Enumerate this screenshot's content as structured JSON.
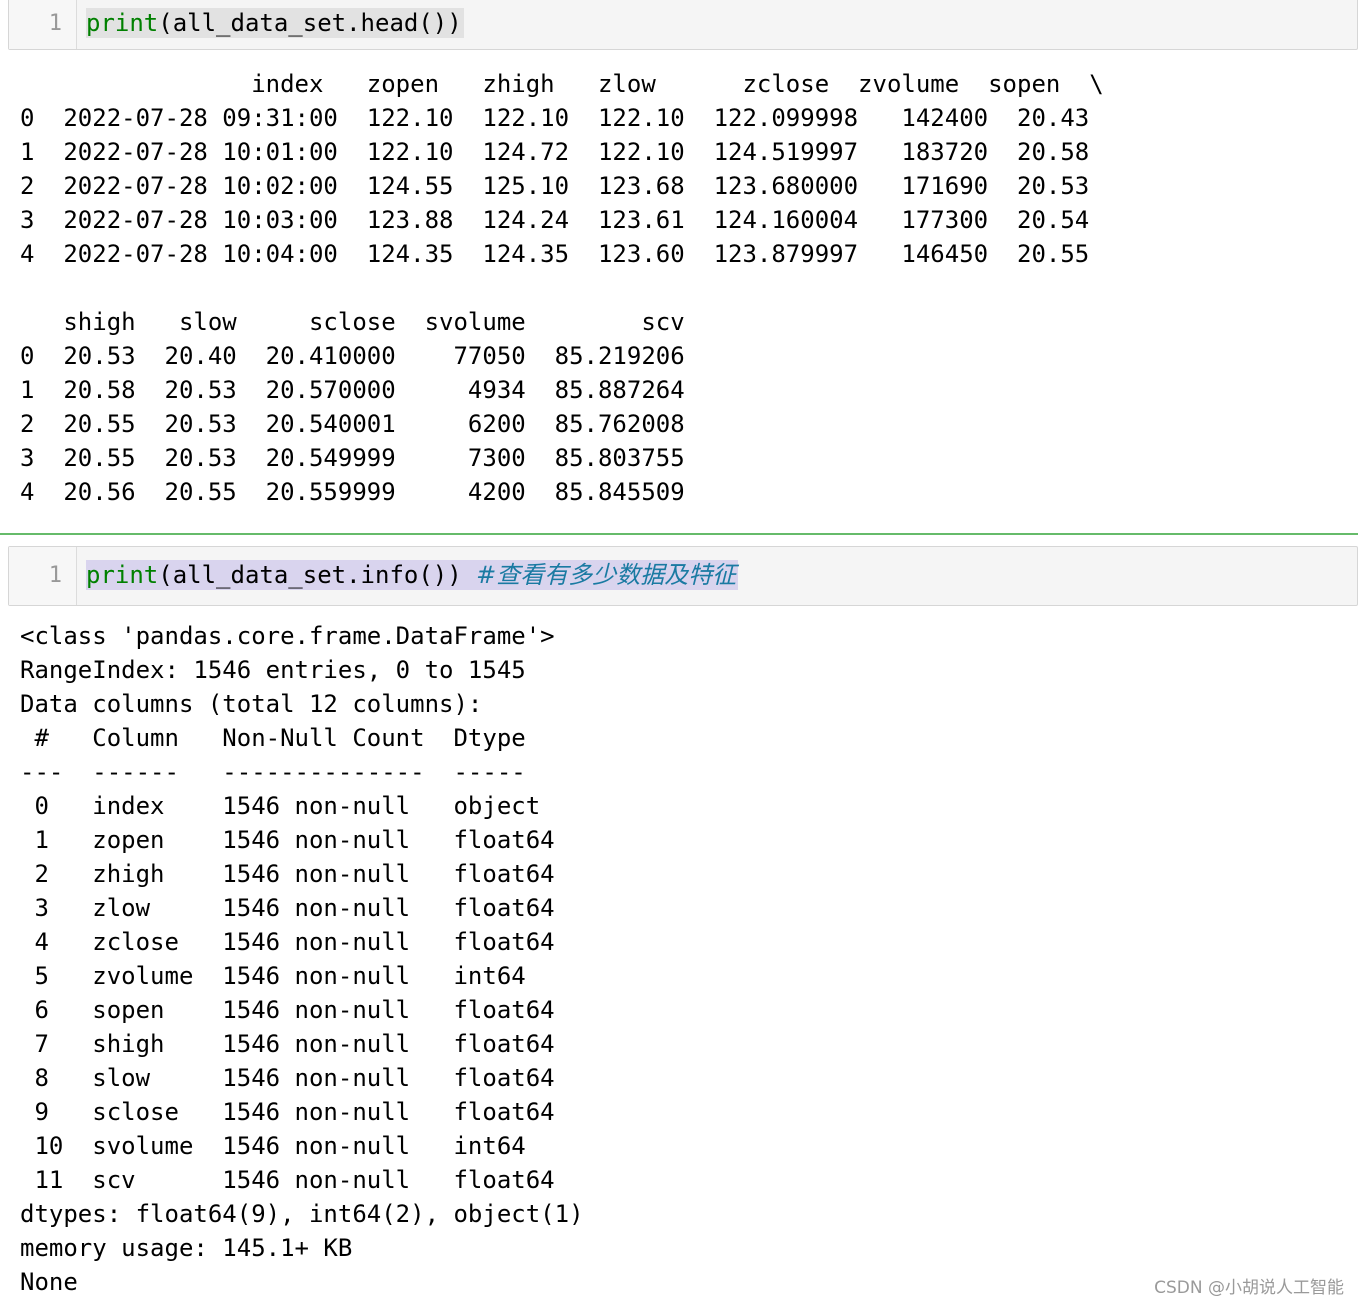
{
  "cell1": {
    "line_number": "1",
    "code_keyword": "print",
    "code_rest": "(all_data_set.head())",
    "output_block1": [
      "                index   zopen   zhigh   zlow      zclose  zvolume  sopen  \\",
      "0  2022-07-28 09:31:00  122.10  122.10  122.10  122.099998   142400  20.43",
      "1  2022-07-28 10:01:00  122.10  124.72  122.10  124.519997   183720  20.58",
      "2  2022-07-28 10:02:00  124.55  125.10  123.68  123.680000   171690  20.53",
      "3  2022-07-28 10:03:00  123.88  124.24  123.61  124.160004   177300  20.54",
      "4  2022-07-28 10:04:00  124.35  124.35  123.60  123.879997   146450  20.55"
    ],
    "output_block2": [
      "   shigh   slow     sclose  svolume        scv",
      "0  20.53  20.40  20.410000    77050  85.219206",
      "1  20.58  20.53  20.570000     4934  85.887264",
      "2  20.55  20.53  20.540001     6200  85.762008",
      "3  20.55  20.53  20.549999     7300  85.803755",
      "4  20.56  20.55  20.559999     4200  85.845509"
    ]
  },
  "cell2": {
    "line_number": "1",
    "code_keyword": "print",
    "code_rest": "(all_data_set.info()) ",
    "code_comment": "#查看有多少数据及特征",
    "output": [
      "<class 'pandas.core.frame.DataFrame'>",
      "RangeIndex: 1546 entries, 0 to 1545",
      "Data columns (total 12 columns):",
      " #   Column   Non-Null Count  Dtype  ",
      "---  ------   --------------  -----  ",
      " 0   index    1546 non-null   object ",
      " 1   zopen    1546 non-null   float64",
      " 2   zhigh    1546 non-null   float64",
      " 3   zlow     1546 non-null   float64",
      " 4   zclose   1546 non-null   float64",
      " 5   zvolume  1546 non-null   int64  ",
      " 6   sopen    1546 non-null   float64",
      " 7   shigh    1546 non-null   float64",
      " 8   slow     1546 non-null   float64",
      " 9   sclose   1546 non-null   float64",
      " 10  svolume  1546 non-null   int64  ",
      " 11  scv      1546 non-null   float64",
      "dtypes: float64(9), int64(2), object(1)",
      "memory usage: 145.1+ KB",
      "None"
    ]
  },
  "watermark": "CSDN @小胡说人工智能",
  "colors": {
    "keyword": "#008000",
    "comment": "#1a7aa2",
    "separator": "#66bb6a"
  }
}
